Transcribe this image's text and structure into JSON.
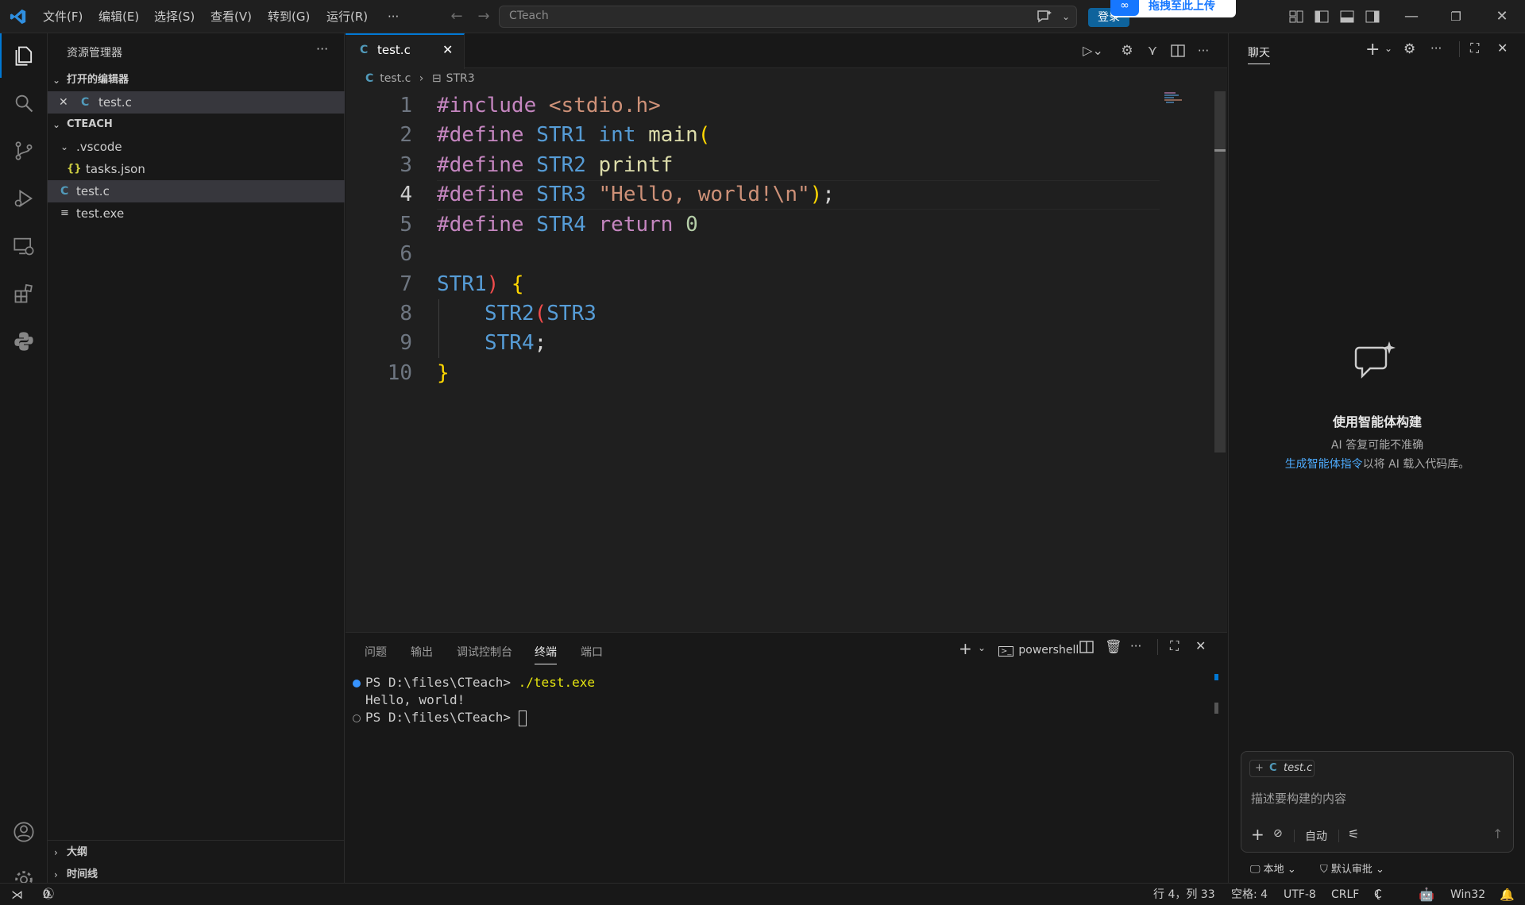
{
  "titlebar": {
    "menus": [
      "文件(F)",
      "编辑(E)",
      "选择(S)",
      "查看(V)",
      "转到(G)",
      "运行(R)",
      "···"
    ],
    "search": "CTeach",
    "login": "登录",
    "banner": "拖拽至此上传"
  },
  "sidebar": {
    "title": "资源管理器",
    "more": "···",
    "open_editors": "打开的编辑器",
    "open_file": "test.c",
    "workspace": "CTEACH",
    "items": [
      {
        "label": ".vscode",
        "icon": "chevron-down-icon"
      },
      {
        "label": "tasks.json",
        "icon": "json-icon",
        "icon_text": "{}"
      },
      {
        "label": "test.c",
        "icon": "c-file-icon",
        "icon_text": "C"
      },
      {
        "label": "test.exe",
        "icon": "file-lines-icon"
      }
    ],
    "outline": "大纲",
    "timeline": "时间线"
  },
  "editor": {
    "tab_label": "test.c",
    "breadcrumb_file": "test.c",
    "breadcrumb_symbol": "STR3",
    "line_numbers": [
      "1",
      "2",
      "3",
      "4",
      "5",
      "6",
      "7",
      "8",
      "9",
      "10"
    ],
    "lines": {
      "l1": {
        "a": "#include ",
        "b": "<stdio.h>"
      },
      "l2": {
        "a": "#define ",
        "b": "STR1 ",
        "c": "int ",
        "d": "main",
        "e": "("
      },
      "l3": {
        "a": "#define ",
        "b": "STR2 ",
        "c": "printf"
      },
      "l4": {
        "a": "#define ",
        "b": "STR3 ",
        "c": "\"Hello, world!\\n\"",
        "d": ")",
        "e": ";"
      },
      "l5": {
        "a": "#define ",
        "b": "STR4 ",
        "c": "return ",
        "d": "0"
      },
      "l7": {
        "a": "STR1",
        "b": ")",
        "c": " {"
      },
      "l8": {
        "a": "STR2",
        "b": "(",
        "c": "STR3"
      },
      "l9": {
        "a": "STR4",
        "b": ";"
      },
      "l10": {
        "a": "}"
      }
    }
  },
  "panel": {
    "tabs": [
      "问题",
      "输出",
      "调试控制台",
      "终端",
      "端口"
    ],
    "active_tab": "终端",
    "shell": "powershell",
    "terminal": {
      "prompt1": "PS D:\\files\\CTeach> ",
      "cmd1": "./test.exe",
      "output": "Hello, world!",
      "prompt2": "PS D:\\files\\CTeach> "
    }
  },
  "chat": {
    "title": "聊天",
    "heading": "使用智能体构建",
    "subtitle": "AI 答复可能不准确",
    "link": "生成智能体指令",
    "link_suffix": "以将 AI 载入代码库。",
    "context_file": "test.c",
    "placeholder": "描述要构建的内容",
    "mode": "自动",
    "location": "本地",
    "approval": "默认审批"
  },
  "statusbar": {
    "errors": "0",
    "warnings": "0",
    "position": "行 4，列 33",
    "spaces": "空格: 4",
    "encoding": "UTF-8",
    "eol": "CRLF",
    "language": "C",
    "platform": "Win32"
  },
  "colors": {
    "accent": "#0078d4",
    "preprocessor": "#c586c0",
    "string": "#ce9178",
    "macro": "#569cd6",
    "function": "#dcdcaa",
    "number": "#b5cea8",
    "link": "#4daafc"
  }
}
